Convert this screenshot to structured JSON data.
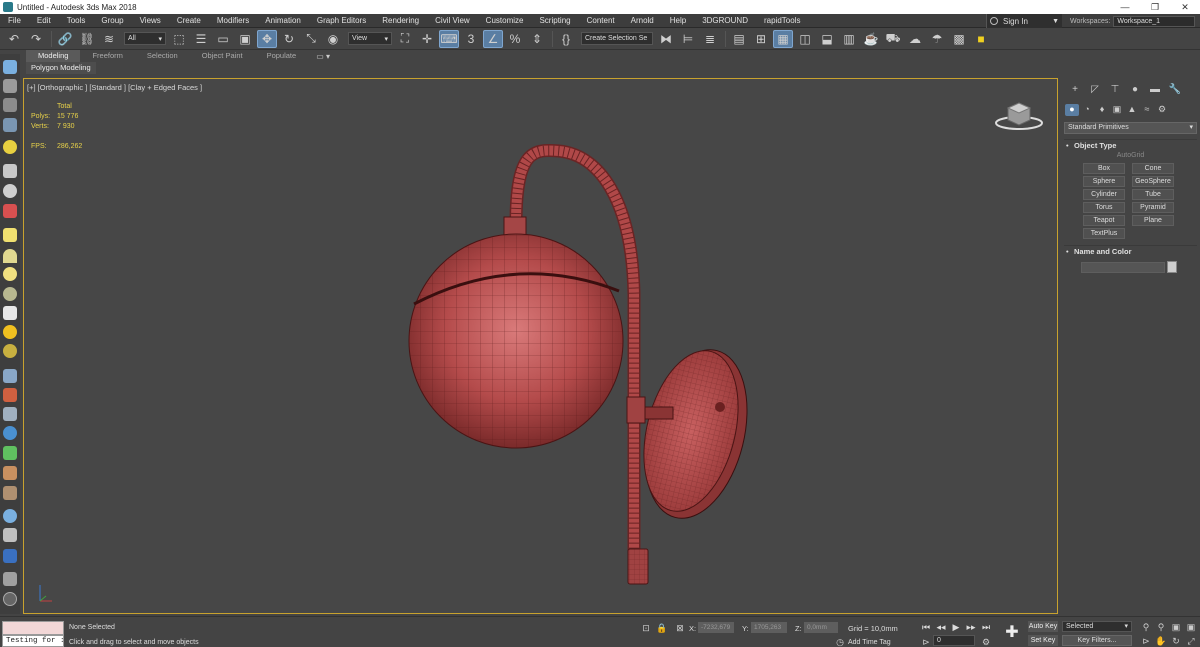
{
  "window": {
    "title": "Untitled - Autodesk 3ds Max 2018",
    "min": "—",
    "max": "❐",
    "close": "✕"
  },
  "menu": [
    "File",
    "Edit",
    "Tools",
    "Group",
    "Views",
    "Create",
    "Modifiers",
    "Animation",
    "Graph Editors",
    "Rendering",
    "Civil View",
    "Customize",
    "Scripting",
    "Content",
    "Arnold",
    "Help",
    "3DGROUND",
    "rapidTools"
  ],
  "signin": {
    "label": "Sign In"
  },
  "workspaces": {
    "label": "Workspaces:",
    "value": "Workspace_1"
  },
  "toolbar": {
    "filter": "All",
    "refcoord": "View",
    "selection_set": "Create Selection Se"
  },
  "ribbon": {
    "tabs": [
      "Modeling",
      "Freeform",
      "Selection",
      "Object Paint",
      "Populate"
    ],
    "active": "Modeling",
    "sub": "Polygon Modeling"
  },
  "viewport": {
    "label": "[+] [Orthographic ] [Standard ] [Clay + Edged Faces ]",
    "stats": {
      "header": "Total",
      "polys_label": "Polys:",
      "polys": "15 776",
      "verts_label": "Verts:",
      "verts": "7 930",
      "fps_label": "FPS:",
      "fps": "286,262"
    }
  },
  "command_panel": {
    "dropdown": "Standard Primitives",
    "object_type": "Object Type",
    "autogrid": "AutoGrid",
    "buttons": [
      "Box",
      "Cone",
      "Sphere",
      "GeoSphere",
      "Cylinder",
      "Tube",
      "Torus",
      "Pyramid",
      "Teapot",
      "Plane",
      "TextPlus"
    ],
    "name_and_color": "Name and Color"
  },
  "status": {
    "maxscript_output": "Testing for :",
    "selection": "None Selected",
    "prompt": "Click and drag to select and move objects",
    "x_label": "X:",
    "x": "-7232,679",
    "y_label": "Y:",
    "y": "1705,263",
    "z_label": "Z:",
    "z": "0,0mm",
    "grid": "Grid = 10,0mm",
    "add_time_tag": "Add Time Tag",
    "frame": "0",
    "auto_key": "Auto Key",
    "set_key": "Set Key",
    "selected": "Selected",
    "key_filters": "Key Filters..."
  },
  "colors": {
    "viewport_bg": "#474747",
    "active_border": "#c8a22e",
    "model": "#b04848",
    "stats_text": "#e8d24a",
    "accent": "#5a7ea3"
  }
}
